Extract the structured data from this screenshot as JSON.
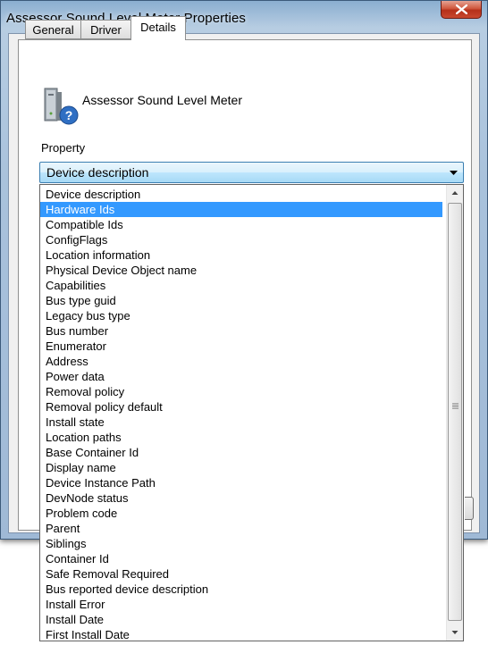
{
  "window": {
    "title": "Assessor Sound Level Meter Properties"
  },
  "tabs": [
    {
      "label": "General"
    },
    {
      "label": "Driver"
    },
    {
      "label": "Details"
    }
  ],
  "details": {
    "device_name": "Assessor Sound Level Meter",
    "icon": "device-unknown-icon",
    "property_label": "Property",
    "selected_property": "Device description"
  },
  "dropdown": {
    "highlighted": "Hardware Ids",
    "items": [
      "Device description",
      "Hardware Ids",
      "Compatible Ids",
      "ConfigFlags",
      "Location information",
      "Physical Device Object name",
      "Capabilities",
      "Bus type guid",
      "Legacy bus type",
      "Bus number",
      "Enumerator",
      "Address",
      "Power data",
      "Removal policy",
      "Removal policy default",
      "Install state",
      "Location paths",
      "Base Container Id",
      "Display name",
      "Device Instance Path",
      "DevNode status",
      "Problem code",
      "Parent",
      "Siblings",
      "Container Id",
      "Safe Removal Required",
      "Bus reported device description",
      "Install Error",
      "Install Date",
      "First Install Date"
    ]
  },
  "colors": {
    "selection": "#3399ff",
    "close_button": "#c9482f",
    "combo_border": "#3c7fb1"
  }
}
